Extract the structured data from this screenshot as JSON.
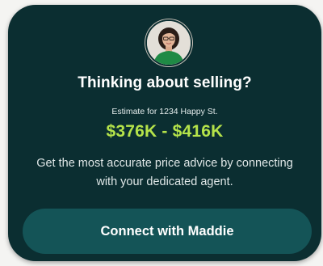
{
  "card": {
    "avatar_name": "agent-avatar",
    "title": "Thinking about selling?",
    "estimate_label": "Estimate for 1234 Happy St.",
    "price_range": "$376K - $416K",
    "description": "Get the most accurate price advice by connecting with your dedicated agent.",
    "cta_label": "Connect with Maddie"
  },
  "colors": {
    "card_background": "#0b2e31",
    "price_accent": "#b5e34a",
    "button_background": "#145457",
    "text_primary": "#ffffff"
  }
}
